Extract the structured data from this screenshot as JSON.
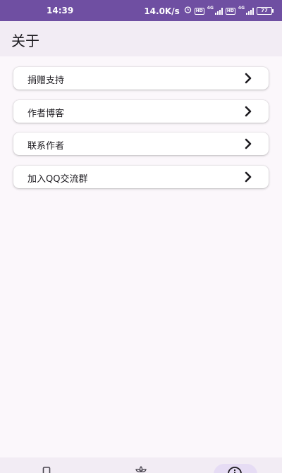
{
  "status_bar": {
    "time": "14:39",
    "net_speed": "14.0K/s",
    "battery": "77",
    "sim1_badge": "HD",
    "sim1_gen": "4G",
    "sim2_badge": "HD",
    "sim2_gen": "4G"
  },
  "header": {
    "title": "关于"
  },
  "menu": {
    "items": [
      {
        "label": "捐赠支持"
      },
      {
        "label": "作者博客"
      },
      {
        "label": "联系作者"
      },
      {
        "label": "加入QQ交流群"
      }
    ]
  },
  "colors": {
    "status_bar": "#6f4fa2",
    "app_bar": "#f2ecf4",
    "background": "#fbf7fb",
    "nav_indicator": "#e6dcf4"
  },
  "icons": {
    "menu_arrow": "chevron-right-icon",
    "nav_1": "phone-icon",
    "nav_2": "flower-icon",
    "nav_3": "info-icon"
  }
}
